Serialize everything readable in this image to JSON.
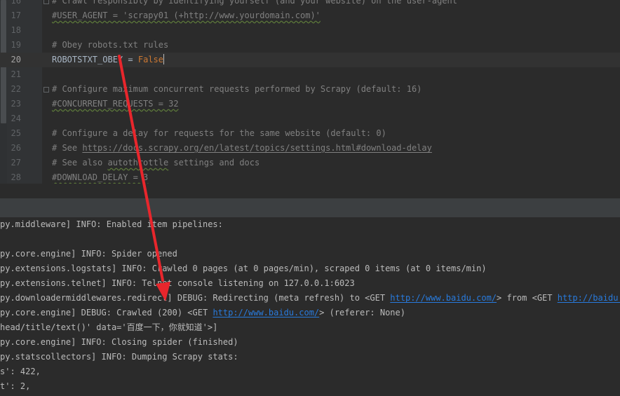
{
  "editor": {
    "lines": [
      {
        "num": "16",
        "text": "# Crawl responsibly by identifying yourself (and your website) on the user-agent"
      },
      {
        "num": "17",
        "text": "#USER_AGENT = 'scrapy01 (+http://www.yourdomain.com)'"
      },
      {
        "num": "18",
        "text": ""
      },
      {
        "num": "19",
        "text": "# Obey robots.txt rules"
      },
      {
        "num": "20",
        "ident": "ROBOTSTXT_OBEY",
        "op": " = ",
        "value": "False"
      },
      {
        "num": "21",
        "text": ""
      },
      {
        "num": "22",
        "text": "# Configure maximum concurrent requests performed by Scrapy (default: 16)"
      },
      {
        "num": "23",
        "text": "#CONCURRENT_REQUESTS = 32"
      },
      {
        "num": "24",
        "text": ""
      },
      {
        "num": "25",
        "text": "# Configure a delay for requests for the same website (default: 0)"
      },
      {
        "num": "26",
        "prefix": "# See ",
        "link": "https://docs.scrapy.org/en/latest/topics/settings.html#download-delay"
      },
      {
        "num": "27",
        "prefix": "# See also ",
        "squiggle": "autothrottle",
        "suffix": " settings and docs"
      },
      {
        "num": "28",
        "text": "#DOWNLOAD_DELAY = 3"
      }
    ]
  },
  "console": {
    "lines": [
      {
        "text": "py.middleware] INFO: Enabled item pipelines:"
      },
      {
        "text": ""
      },
      {
        "text": "py.core.engine] INFO: Spider opened"
      },
      {
        "text": "py.extensions.logstats] INFO: Crawled 0 pages (at 0 pages/min), scraped 0 items (at 0 items/min)"
      },
      {
        "text": "py.extensions.telnet] INFO: Telnet console listening on 127.0.0.1:6023"
      },
      {
        "parts": [
          {
            "t": "py.downloadermiddlewares.redirect] DEBUG: Redirecting (meta refresh) to <GET "
          },
          {
            "t": "http://www.baidu.com/",
            "link": true
          },
          {
            "t": "> from <GET "
          },
          {
            "t": "http://baidu.com/",
            "link": true
          },
          {
            "t": ">"
          }
        ]
      },
      {
        "parts": [
          {
            "t": "py.core.engine] DEBUG: Crawled (200) <GET "
          },
          {
            "t": "http://www.baidu.com/",
            "link": true
          },
          {
            "t": "> (referer: None)"
          }
        ]
      },
      {
        "text": "head/title/text()' data='百度一下，你就知道'>]"
      },
      {
        "text": "py.core.engine] INFO: Closing spider (finished)"
      },
      {
        "text": "py.statscollectors] INFO: Dumping Scrapy stats:"
      },
      {
        "text": "s': 422,"
      },
      {
        "text": "t': 2,"
      }
    ]
  },
  "colors": {
    "accent": "#287bde",
    "arrow": "#e8262c"
  },
  "annotation": {
    "type": "arrow",
    "color": "#e8262c"
  }
}
